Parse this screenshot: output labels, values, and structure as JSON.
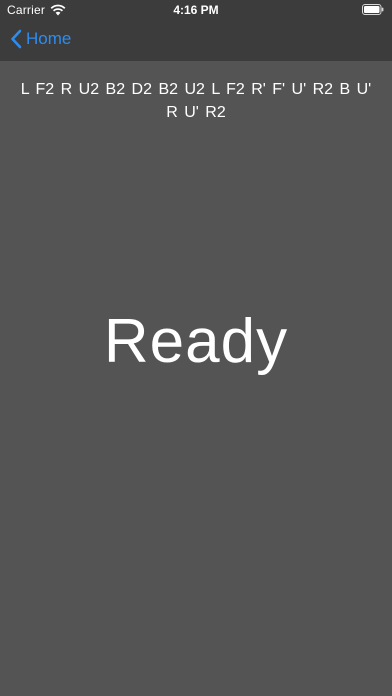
{
  "status_bar": {
    "carrier": "Carrier",
    "time": "4:16 PM",
    "wifi_icon": "wifi-icon",
    "battery_icon": "battery-full-icon"
  },
  "nav": {
    "back_label": "Home",
    "back_icon": "chevron-left-icon",
    "accent_color": "#2d8cf0"
  },
  "main": {
    "scramble": "L F2 R U2 B2 D2 B2 U2 L F2 R' F' U' R2 B U' R U' R2",
    "timer_state": "Ready"
  },
  "colors": {
    "background": "#545454",
    "bars": "#3c3c3c",
    "text": "#ffffff"
  }
}
